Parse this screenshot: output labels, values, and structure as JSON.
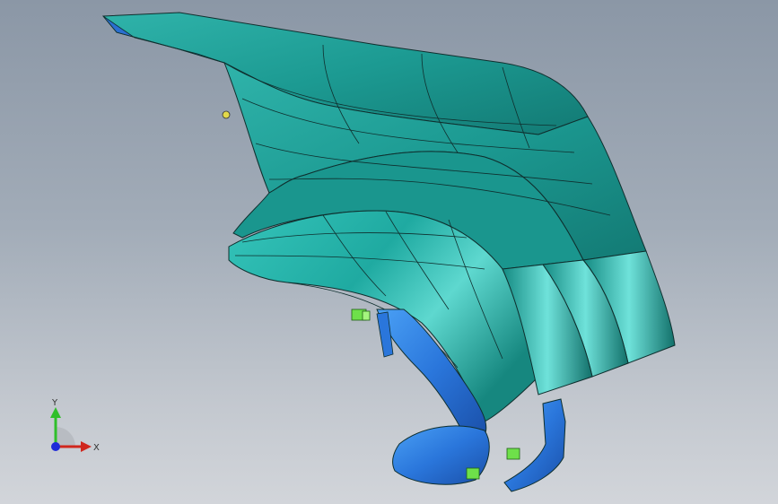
{
  "viewport": {
    "background_top": "#8b97a6",
    "background_bottom": "#d2d5da"
  },
  "model": {
    "primary_color": "#1fa9a0",
    "primary_highlight": "#5fd6cf",
    "secondary_color": "#2f7fe0",
    "fastener_color": "#6ee04a",
    "edge_color": "#0f2f2e"
  },
  "triad": {
    "x_label": "X",
    "y_label": "Y"
  }
}
